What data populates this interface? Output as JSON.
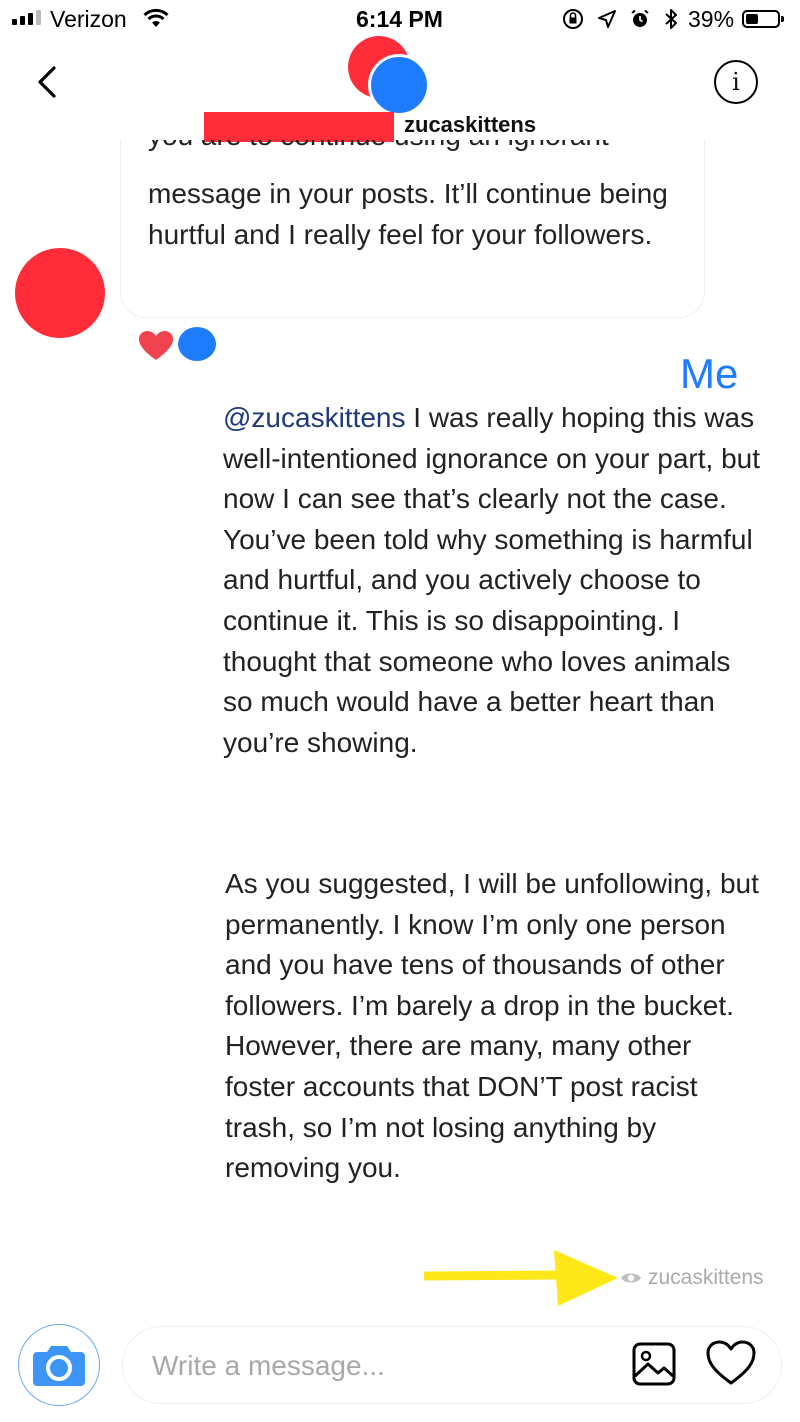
{
  "status_bar": {
    "carrier": "Verizon",
    "time": "6:14 PM",
    "battery_percent": "39%",
    "battery_level": 0.39,
    "icons": [
      "signal-icon",
      "wifi-icon",
      "orientation-lock-icon",
      "location-icon",
      "alarm-icon",
      "bluetooth-icon",
      "battery-icon"
    ]
  },
  "header": {
    "username": "zucaskittens",
    "back_icon": "chevron-left-icon",
    "info_icon": "info-icon",
    "info_glyph": "i"
  },
  "conversation": {
    "received": {
      "cut_text": "you are to continue using an ignorant",
      "text": "message in your posts. It’ll continue being hurtful and I really feel for your followers.",
      "reaction": "heart-icon"
    },
    "annotation_label": "Me",
    "sent": {
      "mention": "@zucaskittens",
      "text_part1": " I was really hoping this was well-intentioned ignorance on your part, but now I can see that’s clearly not the case. You’ve been told why something is harmful and hurtful, and you actively choose to continue it. This is so disappointing. I thought that someone who loves animals so much would have a better heart than you’re showing.",
      "text_part2": "As you suggested, I will be unfollowing, but permanently. I know I’m only one person and you have tens of thousands of other followers. I’m barely a drop in the bucket. However, there are many, many other foster accounts that DON’T post racist trash, so I’m not losing anything by removing you."
    },
    "seen_by": "zucaskittens"
  },
  "composer": {
    "placeholder": "Write a message...",
    "value": "",
    "camera_icon": "camera-icon",
    "gallery_icon": "gallery-icon",
    "like_icon": "heart-icon"
  },
  "colors": {
    "accent_blue": "#1f7cff",
    "redaction_red": "#ff2d3a",
    "annotation_yellow": "#ffe81a"
  }
}
